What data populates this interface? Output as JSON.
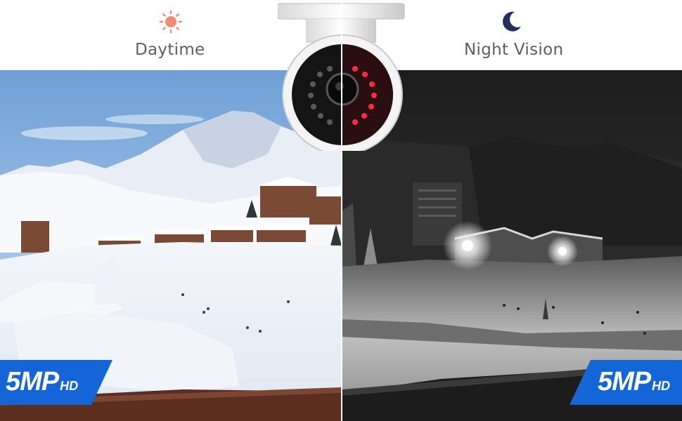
{
  "labels": {
    "day": "Daytime",
    "night": "Night Vision"
  },
  "badges": {
    "resolution": "5MP",
    "suffix": "HD"
  },
  "icons": {
    "day": "sun-icon",
    "night": "moon-icon"
  },
  "colors": {
    "sun": "#f28b76",
    "moon": "#23305e",
    "badge": "#1466d8",
    "ir_led": "#ff2a3a"
  }
}
